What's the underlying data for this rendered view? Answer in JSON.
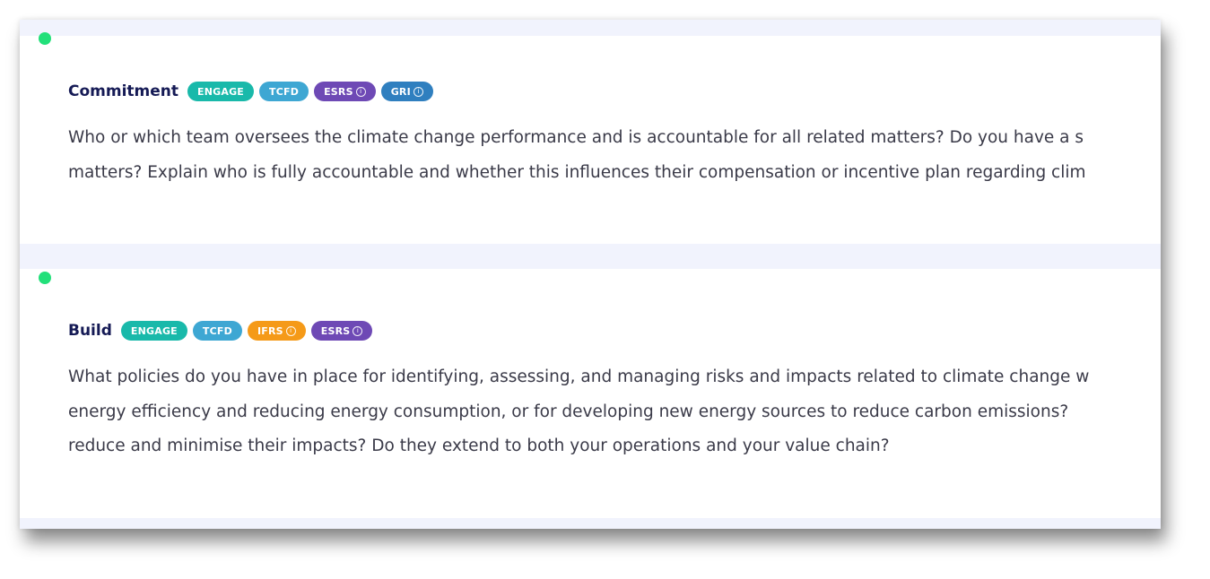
{
  "colors": {
    "engage": "#19b9aa",
    "tcfd": "#3ea7d3",
    "esrs": "#6e49b5",
    "gri": "#2f7fbf",
    "ifrs": "#f59a18",
    "status_dot": "#22e07a",
    "title": "#151a55",
    "body_text": "#3a3a48",
    "band": "#f1f3fd"
  },
  "cards": [
    {
      "category": "Commitment",
      "tags": [
        {
          "label": "ENGAGE",
          "color_key": "engage",
          "info_icon": false
        },
        {
          "label": "TCFD",
          "color_key": "tcfd",
          "info_icon": false
        },
        {
          "label": "ESRS",
          "color_key": "esrs",
          "info_icon": true
        },
        {
          "label": "GRI",
          "color_key": "gri",
          "info_icon": true
        }
      ],
      "question_lines": [
        "Who or which team oversees the climate change performance and is accountable for all related matters? Do you have a s",
        "matters? Explain who is fully accountable and whether this influences their compensation or incentive plan regarding clim"
      ]
    },
    {
      "category": "Build",
      "tags": [
        {
          "label": "ENGAGE",
          "color_key": "engage",
          "info_icon": false
        },
        {
          "label": "TCFD",
          "color_key": "tcfd",
          "info_icon": false
        },
        {
          "label": "IFRS",
          "color_key": "ifrs",
          "info_icon": true
        },
        {
          "label": "ESRS",
          "color_key": "esrs",
          "info_icon": true
        }
      ],
      "question_lines": [
        "What policies do you have in place for identifying, assessing, and managing risks and impacts related to climate change w",
        "energy efficiency and reducing energy consumption, or for developing new energy sources to reduce carbon emissions?",
        "reduce and minimise their impacts? Do they extend to both your operations and your value chain?"
      ]
    }
  ]
}
